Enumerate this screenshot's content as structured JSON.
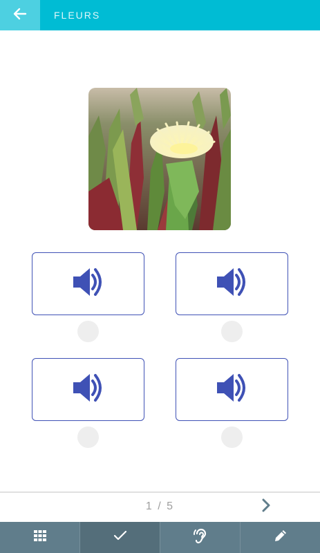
{
  "header": {
    "title": "FLEURS",
    "back_icon": "arrow-left-icon",
    "color": "#00bcd4",
    "back_color": "#4dd0e1"
  },
  "main": {
    "image": "yellow-ice-plant-flower",
    "options": [
      {
        "icon": "speaker-icon"
      },
      {
        "icon": "speaker-icon"
      },
      {
        "icon": "speaker-icon"
      },
      {
        "icon": "speaker-icon"
      }
    ],
    "accent_color": "#3f51b5"
  },
  "pager": {
    "label": "1 / 5",
    "next_icon": "chevron-right-icon"
  },
  "bottom_bar": {
    "color": "#607d8b",
    "tabs": [
      {
        "icon": "grid-icon",
        "active": false
      },
      {
        "icon": "check-icon",
        "active": true
      },
      {
        "icon": "hearing-icon",
        "active": false
      },
      {
        "icon": "pencil-icon",
        "active": false
      }
    ]
  }
}
